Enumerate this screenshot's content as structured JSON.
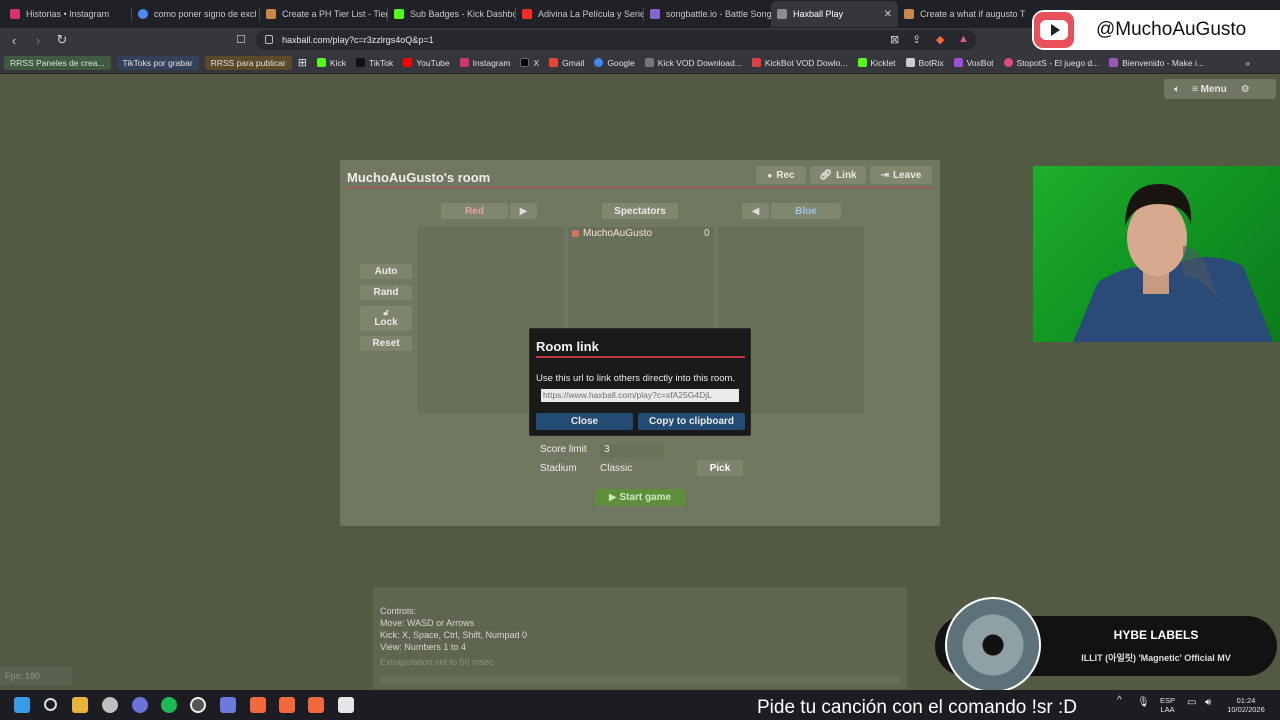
{
  "tabs": [
    {
      "label": "Historias • Instagram",
      "color": "#d6336c"
    },
    {
      "label": "como poner signo de excl",
      "color": "#4a8af4"
    },
    {
      "label": "Create a PH Tier List - Tier",
      "color": "#c9874a"
    },
    {
      "label": "Sub Badges - Kick Dashbo",
      "color": "#53fc18"
    },
    {
      "label": "Adivina La Película y Serie",
      "color": "#ff2b2b"
    },
    {
      "label": "songbattle.io - Battle Song",
      "color": "#8a63d2"
    },
    {
      "label": "Haxball Play",
      "color": "#8c8c8c"
    },
    {
      "label": "Create a what if augusto T",
      "color": "#c9874a"
    }
  ],
  "address": {
    "url": "haxball.com/play?c=r3zzlrgs4oQ&p=1"
  },
  "bookmarks": [
    {
      "label": "RRSS Paneles de crea...",
      "tag": "#3f5a3f"
    },
    {
      "label": "TikToks por grabar",
      "tag": "#34415a"
    },
    {
      "label": "RRSS para publicar",
      "tag": "#5a4a2a"
    },
    {
      "label": "Kick",
      "color": "#53fc18"
    },
    {
      "label": "TikTok",
      "color": "#111111"
    },
    {
      "label": "YouTube",
      "color": "#ff0000"
    },
    {
      "label": "Instagram",
      "color": "#d6336c"
    },
    {
      "label": "X",
      "color": "#000000"
    },
    {
      "label": "Gmail",
      "color": "#ea4335"
    },
    {
      "label": "Google",
      "color": "#4285f4"
    },
    {
      "label": "Kick VOD Download...",
      "color": "#777777"
    },
    {
      "label": "KickBot VOD Dowlo...",
      "color": "#e04040"
    },
    {
      "label": "Kicklet",
      "color": "#53fc18"
    },
    {
      "label": "BotRix",
      "color": "#cccccc"
    },
    {
      "label": "VoxBot",
      "color": "#a14fd8"
    },
    {
      "label": "StopotS - El juego d...",
      "color": "#e34a7c"
    },
    {
      "label": "Bienvenido - Make i...",
      "color": "#9b59b6"
    }
  ],
  "youtube_badge": {
    "handle": "@MuchoAuGusto"
  },
  "game_menu": {
    "menu_label": "≡ Menu"
  },
  "room": {
    "title": "MuchoAuGusto's room",
    "rec": "Rec",
    "link": "Link",
    "leave": "Leave",
    "red": "Red",
    "spectators": "Spectators",
    "blue": "Blue",
    "auto": "Auto",
    "rand": "Rand",
    "lock": "Lock",
    "reset": "Reset",
    "player_name": "MuchoAuGusto",
    "player_score": "0",
    "score_limit_label": "Score limit",
    "score_limit_value": "3",
    "stadium_label": "Stadium",
    "stadium_value": "Classic",
    "pick": "Pick",
    "start_game": "▶ Start game"
  },
  "dialog": {
    "title": "Room link",
    "text": "Use this url to link others directly into this room.",
    "url": "https://www.haxball.com/play?c=xfA25G4DjL",
    "close": "Close",
    "copy": "Copy to clipboard"
  },
  "controls": {
    "line1": "Controls:",
    "line2": "Move: WASD or Arrows",
    "line3": "Kick: X, Space, Ctrl, Shift, Numpad 0",
    "line4": "View: Numbers 1 to 4",
    "line5": "Extrapolation set to 50 msec"
  },
  "fps": "Fps: 180",
  "music": {
    "artist": "HYBE LABELS",
    "song": "ILLIT (아일릿) 'Magnetic' Official MV"
  },
  "overlay_text": "Pide tu canción con el comando !sr :D",
  "tray": {
    "lang1": "ESP",
    "lang2": "LAA",
    "time": "01:24",
    "date": "10/02/2026"
  }
}
